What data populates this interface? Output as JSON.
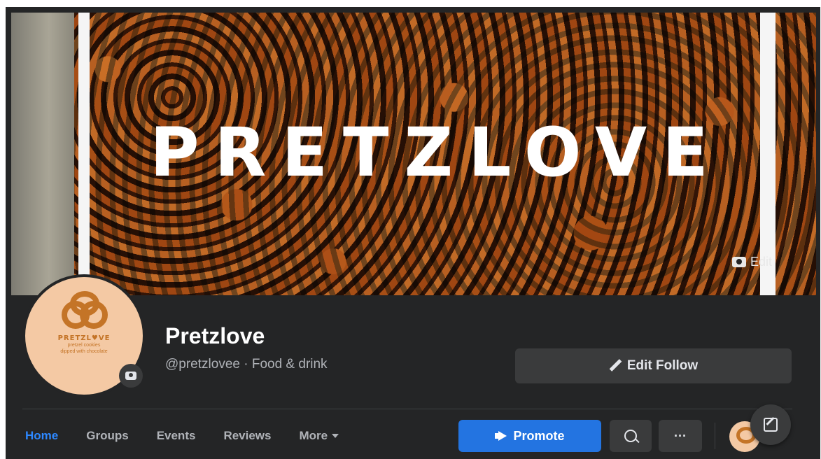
{
  "cover": {
    "title_text": "PRETZLOVE",
    "edit_label": "Edit"
  },
  "profile": {
    "logo_text": "PRETZL♥VE",
    "logo_subtext_1": "pretzel cookies",
    "logo_subtext_2": "dipped with chocolate",
    "name": "Pretzlove",
    "handle_category": "@pretzlovee · Food & drink",
    "edit_follow_label": "Edit Follow"
  },
  "nav": {
    "items": [
      {
        "label": "Home",
        "active": true
      },
      {
        "label": "Groups",
        "active": false
      },
      {
        "label": "Events",
        "active": false
      },
      {
        "label": "Reviews",
        "active": false
      },
      {
        "label": "More",
        "active": false
      }
    ],
    "promote_label": "Promote",
    "more_options_label": "···"
  },
  "colors": {
    "background": "#242526",
    "accent": "#2374e1",
    "active_tab": "#2d88ff",
    "button": "#3a3b3c",
    "text_primary": "#ffffff",
    "text_secondary": "#b0b3b8"
  },
  "icons": [
    "camera-icon",
    "pencil-icon",
    "caret-down-icon",
    "megaphone-icon",
    "search-icon",
    "more-icon",
    "compose-icon"
  ]
}
